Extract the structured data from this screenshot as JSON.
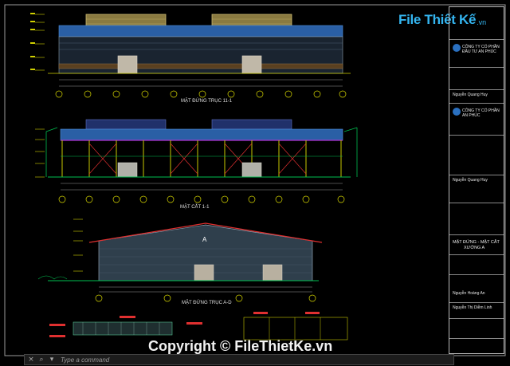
{
  "logo": {
    "text": "File Thiết Kế",
    "domain": ".vn"
  },
  "drawings": {
    "elevation_1": {
      "title": "MẶT ĐỨNG TRỤC 11-1"
    },
    "section_1": {
      "title": "MẶT CẮT 1-1"
    },
    "elevation_2": {
      "title": "MẶT ĐỨNG TRỤC A-D"
    },
    "marker_a": "A"
  },
  "title_block": {
    "company_1": "CÔNG TY CỔ PHẦN",
    "company_1b": "ĐẦU TƯ AN PHÚC",
    "company_2": "CÔNG TY CỔ PHẦN",
    "company_2b": "AN PHÚC",
    "person_1": "Nguyễn Quang Huy",
    "person_2": "Nguyễn Quang Huy",
    "drawing_name": "MẶT ĐỨNG - MẶT CẮT",
    "drawing_name_2": "XƯỞNG A",
    "person_3": "Nguyễn Hoàng An",
    "person_4": "Nguyễn Thị Diễm Linh"
  },
  "watermark": "Copyright © FileThietKe.vn",
  "command_line": {
    "placeholder": "Type a command"
  },
  "colors": {
    "background": "#000000",
    "roof": "#2a5fa5",
    "wall": "#3b5468",
    "structure": "#c8c800",
    "purple": "#b030d0",
    "green": "#00c050",
    "red": "#e03030"
  }
}
